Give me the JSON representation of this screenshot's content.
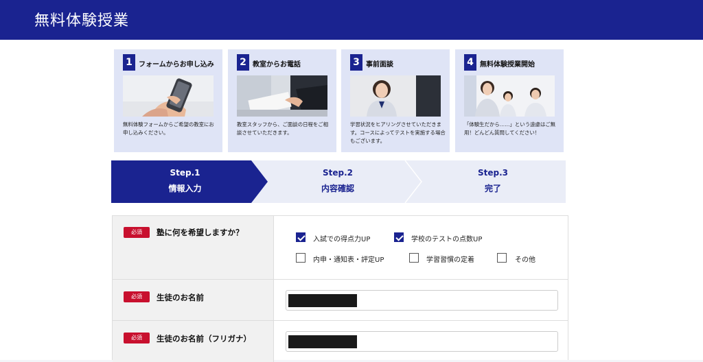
{
  "header": {
    "title": "無料体験授業"
  },
  "cards": [
    {
      "num": "1",
      "title": "フォームからお申し込み",
      "desc": "無料体験フォームからご希望の教室にお申し込みください。"
    },
    {
      "num": "2",
      "title": "教室からお電話",
      "desc": "教室スタッフから、ご面談の日程をご相談させていただきます。"
    },
    {
      "num": "3",
      "title": "事前面談",
      "desc": "学習状況をヒアリングさせていただきます。コースによってテストを実施する場合もございます。"
    },
    {
      "num": "4",
      "title": "無料体験授業開始",
      "desc": "「体験生だから……」という遠慮はご無用！どんどん質問してください！"
    }
  ],
  "steps": [
    {
      "num": "Step.1",
      "label": "情報入力",
      "active": true
    },
    {
      "num": "Step.2",
      "label": "内容確認",
      "active": false
    },
    {
      "num": "Step.3",
      "label": "完了",
      "active": false
    }
  ],
  "form": {
    "required_badge": "必須",
    "q1": {
      "label": "塾に何を希望しますか？",
      "options": [
        {
          "label": "入試での得点力UP",
          "checked": true
        },
        {
          "label": "学校のテストの点数UP",
          "checked": true
        },
        {
          "label": "内申・通知表・評定UP",
          "checked": false
        },
        {
          "label": "学習習慣の定着",
          "checked": false
        },
        {
          "label": "その他",
          "checked": false
        }
      ]
    },
    "name": {
      "label": "生徒のお名前"
    },
    "kana": {
      "label": "生徒のお名前（フリガナ）"
    }
  },
  "colors": {
    "brand": "#1a2390",
    "required": "#c8102e",
    "card_bg": "#dfe4f6"
  }
}
